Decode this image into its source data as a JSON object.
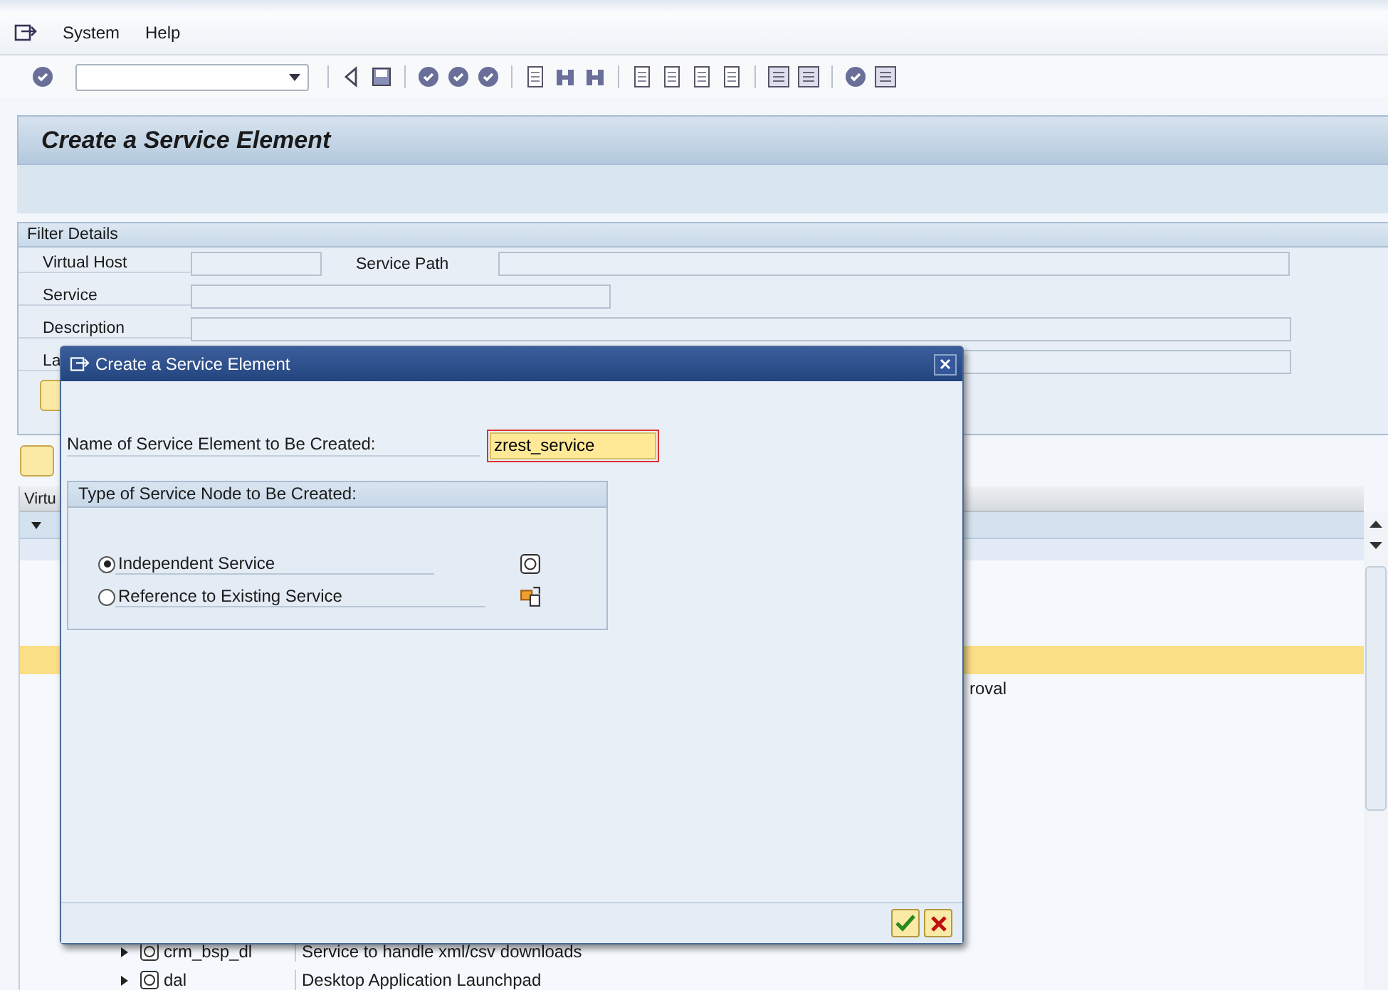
{
  "menu_bar": {
    "items": [
      "System",
      "Help"
    ]
  },
  "page_title": "Create a Service Element",
  "filter_details": {
    "title": "Filter Details",
    "fields": [
      {
        "label": "Virtual Host"
      },
      {
        "label": "Service Path"
      },
      {
        "label": "Service"
      },
      {
        "label": "Description"
      },
      {
        "label": "La"
      }
    ]
  },
  "table": {
    "columns": [
      "Virtu"
    ],
    "rows": [
      {
        "expanded": true,
        "selected": false
      },
      {
        "selected": true
      },
      {
        "description": "roval",
        "selected": false
      },
      {
        "expanded": false,
        "name": "crm_bsp_dl",
        "description": "Service to handle xml/csv downloads",
        "selected": false
      },
      {
        "expanded": false,
        "name": "dal",
        "description": "Desktop Application Launchpad",
        "selected": false
      }
    ]
  },
  "dialog": {
    "title": "Create a Service Element",
    "name_field": {
      "label": "Name of Service Element to Be Created:",
      "value": "zrest_service"
    },
    "node_type": {
      "title": "Type of Service Node to Be Created:",
      "options": [
        {
          "label": "Independent Service",
          "selected": true
        },
        {
          "label": "Reference to Existing Service",
          "selected": false
        }
      ]
    }
  }
}
